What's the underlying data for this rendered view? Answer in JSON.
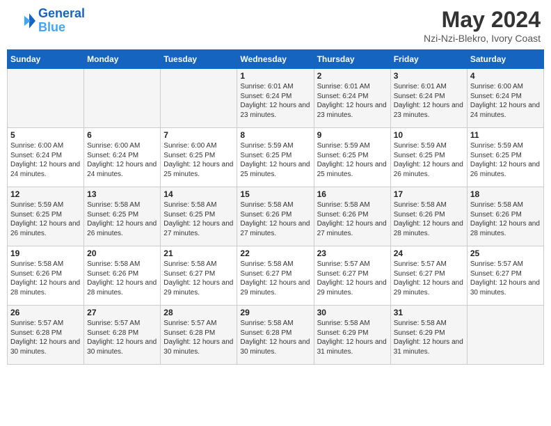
{
  "logo": {
    "line1": "General",
    "line2": "Blue"
  },
  "title": "May 2024",
  "location": "Nzi-Nzi-Blekro, Ivory Coast",
  "days_of_week": [
    "Sunday",
    "Monday",
    "Tuesday",
    "Wednesday",
    "Thursday",
    "Friday",
    "Saturday"
  ],
  "weeks": [
    [
      {
        "day": "",
        "info": ""
      },
      {
        "day": "",
        "info": ""
      },
      {
        "day": "",
        "info": ""
      },
      {
        "day": "1",
        "sunrise": "6:01 AM",
        "sunset": "6:24 PM",
        "daylight": "12 hours and 23 minutes."
      },
      {
        "day": "2",
        "sunrise": "6:01 AM",
        "sunset": "6:24 PM",
        "daylight": "12 hours and 23 minutes."
      },
      {
        "day": "3",
        "sunrise": "6:01 AM",
        "sunset": "6:24 PM",
        "daylight": "12 hours and 23 minutes."
      },
      {
        "day": "4",
        "sunrise": "6:00 AM",
        "sunset": "6:24 PM",
        "daylight": "12 hours and 24 minutes."
      }
    ],
    [
      {
        "day": "5",
        "sunrise": "6:00 AM",
        "sunset": "6:24 PM",
        "daylight": "12 hours and 24 minutes."
      },
      {
        "day": "6",
        "sunrise": "6:00 AM",
        "sunset": "6:24 PM",
        "daylight": "12 hours and 24 minutes."
      },
      {
        "day": "7",
        "sunrise": "6:00 AM",
        "sunset": "6:25 PM",
        "daylight": "12 hours and 25 minutes."
      },
      {
        "day": "8",
        "sunrise": "5:59 AM",
        "sunset": "6:25 PM",
        "daylight": "12 hours and 25 minutes."
      },
      {
        "day": "9",
        "sunrise": "5:59 AM",
        "sunset": "6:25 PM",
        "daylight": "12 hours and 25 minutes."
      },
      {
        "day": "10",
        "sunrise": "5:59 AM",
        "sunset": "6:25 PM",
        "daylight": "12 hours and 26 minutes."
      },
      {
        "day": "11",
        "sunrise": "5:59 AM",
        "sunset": "6:25 PM",
        "daylight": "12 hours and 26 minutes."
      }
    ],
    [
      {
        "day": "12",
        "sunrise": "5:59 AM",
        "sunset": "6:25 PM",
        "daylight": "12 hours and 26 minutes."
      },
      {
        "day": "13",
        "sunrise": "5:58 AM",
        "sunset": "6:25 PM",
        "daylight": "12 hours and 26 minutes."
      },
      {
        "day": "14",
        "sunrise": "5:58 AM",
        "sunset": "6:25 PM",
        "daylight": "12 hours and 27 minutes."
      },
      {
        "day": "15",
        "sunrise": "5:58 AM",
        "sunset": "6:26 PM",
        "daylight": "12 hours and 27 minutes."
      },
      {
        "day": "16",
        "sunrise": "5:58 AM",
        "sunset": "6:26 PM",
        "daylight": "12 hours and 27 minutes."
      },
      {
        "day": "17",
        "sunrise": "5:58 AM",
        "sunset": "6:26 PM",
        "daylight": "12 hours and 28 minutes."
      },
      {
        "day": "18",
        "sunrise": "5:58 AM",
        "sunset": "6:26 PM",
        "daylight": "12 hours and 28 minutes."
      }
    ],
    [
      {
        "day": "19",
        "sunrise": "5:58 AM",
        "sunset": "6:26 PM",
        "daylight": "12 hours and 28 minutes."
      },
      {
        "day": "20",
        "sunrise": "5:58 AM",
        "sunset": "6:26 PM",
        "daylight": "12 hours and 28 minutes."
      },
      {
        "day": "21",
        "sunrise": "5:58 AM",
        "sunset": "6:27 PM",
        "daylight": "12 hours and 29 minutes."
      },
      {
        "day": "22",
        "sunrise": "5:58 AM",
        "sunset": "6:27 PM",
        "daylight": "12 hours and 29 minutes."
      },
      {
        "day": "23",
        "sunrise": "5:57 AM",
        "sunset": "6:27 PM",
        "daylight": "12 hours and 29 minutes."
      },
      {
        "day": "24",
        "sunrise": "5:57 AM",
        "sunset": "6:27 PM",
        "daylight": "12 hours and 29 minutes."
      },
      {
        "day": "25",
        "sunrise": "5:57 AM",
        "sunset": "6:27 PM",
        "daylight": "12 hours and 30 minutes."
      }
    ],
    [
      {
        "day": "26",
        "sunrise": "5:57 AM",
        "sunset": "6:28 PM",
        "daylight": "12 hours and 30 minutes."
      },
      {
        "day": "27",
        "sunrise": "5:57 AM",
        "sunset": "6:28 PM",
        "daylight": "12 hours and 30 minutes."
      },
      {
        "day": "28",
        "sunrise": "5:57 AM",
        "sunset": "6:28 PM",
        "daylight": "12 hours and 30 minutes."
      },
      {
        "day": "29",
        "sunrise": "5:58 AM",
        "sunset": "6:28 PM",
        "daylight": "12 hours and 30 minutes."
      },
      {
        "day": "30",
        "sunrise": "5:58 AM",
        "sunset": "6:29 PM",
        "daylight": "12 hours and 31 minutes."
      },
      {
        "day": "31",
        "sunrise": "5:58 AM",
        "sunset": "6:29 PM",
        "daylight": "12 hours and 31 minutes."
      },
      {
        "day": "",
        "info": ""
      }
    ]
  ],
  "labels": {
    "sunrise_prefix": "Sunrise: ",
    "sunset_prefix": "Sunset: ",
    "daylight_prefix": "Daylight: "
  }
}
